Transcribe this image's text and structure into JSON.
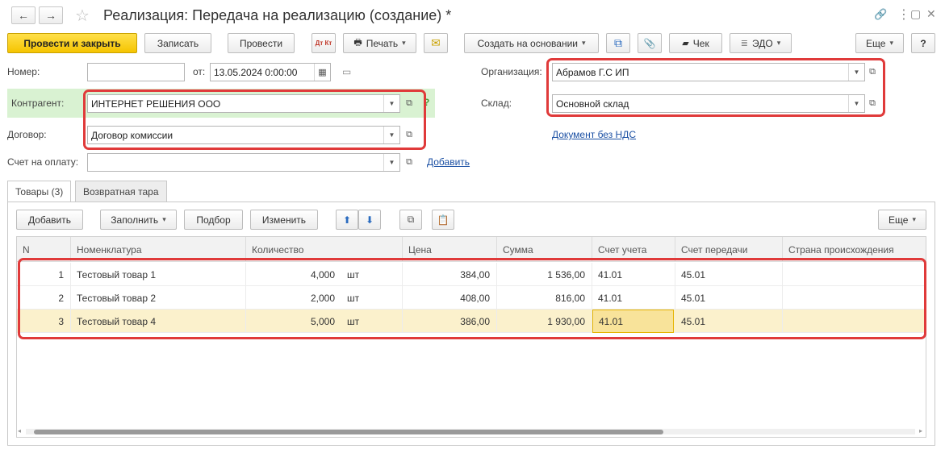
{
  "window": {
    "title": "Реализация: Передача на реализацию (создание) *",
    "back_label": "←",
    "forward_label": "→",
    "star": "☆",
    "link_glyph": "🔗",
    "more_glyph": "⋮",
    "maximize_glyph": "▢",
    "close_glyph": "✕"
  },
  "toolbar": {
    "post_close": "Провести и закрыть",
    "save": "Записать",
    "post": "Провести",
    "dt_kt": "Дт Кт",
    "print": "Печать",
    "mail_glyph": "✉",
    "create_based": "Создать на основании",
    "structure_glyph": "⧉",
    "attach_glyph": "📎",
    "check": "Чек",
    "edo": "ЭДО",
    "more": "Еще",
    "help": "?"
  },
  "form": {
    "number_label": "Номер:",
    "number_value": "",
    "from_label": "от:",
    "date_value": "13.05.2024  0:00:00",
    "org_label": "Организация:",
    "org_value": "Абрамов Г.С ИП",
    "counterparty_label": "Контрагент:",
    "counterparty_value": "ИНТЕРНЕТ РЕШЕНИЯ ООО",
    "question": "?",
    "warehouse_label": "Склад:",
    "warehouse_value": "Основной склад",
    "contract_label": "Договор:",
    "contract_value": "Договор комиссии",
    "vat_link": "Документ без НДС",
    "invoice_label": "Счет на оплату:",
    "invoice_value": "",
    "add_link": "Добавить"
  },
  "tabs": [
    {
      "label": "Товары (3)"
    },
    {
      "label": "Возвратная тара"
    }
  ],
  "table_toolbar": {
    "add": "Добавить",
    "fill": "Заполнить",
    "pick": "Подбор",
    "change": "Изменить",
    "up_glyph": "⬆",
    "down_glyph": "⬇",
    "more": "Еще"
  },
  "table": {
    "headers": [
      "N",
      "Номенклатура",
      "Количество",
      "Цена",
      "Сумма",
      "Счет учета",
      "Счет передачи",
      "Страна происхождения"
    ],
    "rows": [
      {
        "n": "1",
        "name": "Тестовый товар 1",
        "qty": "4,000",
        "unit": "шт",
        "price": "384,00",
        "sum": "1 536,00",
        "account": "41.01",
        "transfer": "45.01",
        "country": ""
      },
      {
        "n": "2",
        "name": "Тестовый товар 2",
        "qty": "2,000",
        "unit": "шт",
        "price": "408,00",
        "sum": "816,00",
        "account": "41.01",
        "transfer": "45.01",
        "country": ""
      },
      {
        "n": "3",
        "name": "Тестовый товар 4",
        "qty": "5,000",
        "unit": "шт",
        "price": "386,00",
        "sum": "1 930,00",
        "account": "41.01",
        "transfer": "45.01",
        "country": ""
      }
    ]
  },
  "colors": {
    "highlight": "#e03a3a",
    "primary_button": "#f5c400",
    "selected_row": "#fbf1cc",
    "link": "#1a4fa3"
  }
}
